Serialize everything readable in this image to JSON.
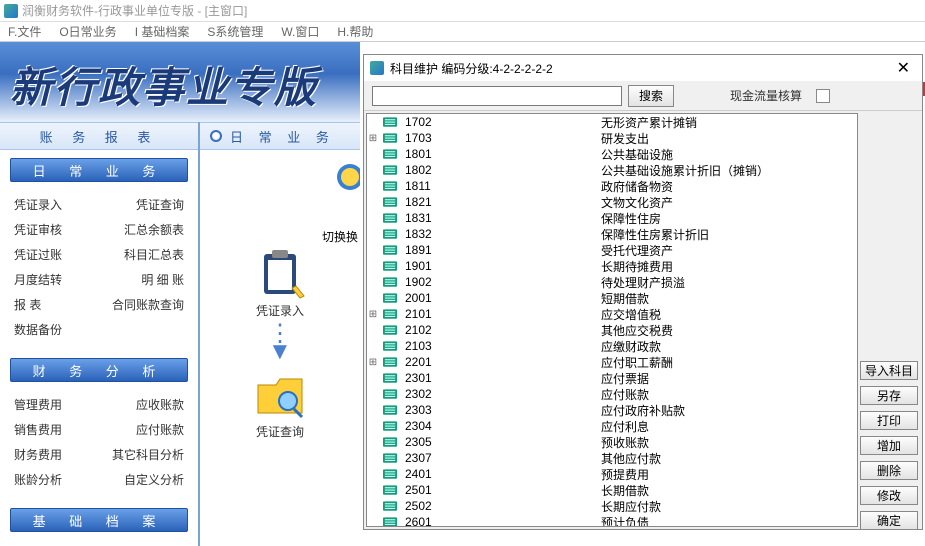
{
  "window_title": "润衡财务软件-行政事业单位专版 - [主窗口]",
  "menu": [
    "F.文件",
    "O日常业务",
    "I 基础档案",
    "S系统管理",
    "W.窗口",
    "H.帮助"
  ],
  "banner": "新行政事业专版",
  "left": {
    "panel1_title": "账 务 报 表",
    "band1": "日 常 业 务",
    "links1": [
      [
        "凭证录入",
        "凭证查询"
      ],
      [
        "凭证审核",
        "汇总余额表"
      ],
      [
        "凭证过账",
        "科目汇总表"
      ],
      [
        "月度结转",
        "明 细 账"
      ],
      [
        "报    表",
        "合同账款查询"
      ],
      [
        "数据备份",
        ""
      ]
    ],
    "band2": "财 务 分 析",
    "links2": [
      [
        "管理费用",
        "应收账款"
      ],
      [
        "销售费用",
        "应付账款"
      ],
      [
        "财务费用",
        "其它科目分析"
      ],
      [
        "账龄分析",
        "自定义分析"
      ]
    ],
    "band3": "基 础 档 案"
  },
  "mid": {
    "title": "日 常 业 务",
    "switch_label": "切换换",
    "icon1_label": "凭证录入",
    "icon2_label": "凭证查询"
  },
  "dialog": {
    "title": "科目维护  编码分级:4-2-2-2-2-2",
    "search_btn": "搜索",
    "cash_label": "现金流量核算",
    "buttons": [
      "导入科目",
      "另存",
      "打印",
      "增加",
      "删除",
      "修改",
      "确定"
    ],
    "rows": [
      {
        "exp": "",
        "code": "1702",
        "name": "无形资产累计摊销"
      },
      {
        "exp": "+",
        "code": "1703",
        "name": "研发支出"
      },
      {
        "exp": "",
        "code": "1801",
        "name": "公共基础设施"
      },
      {
        "exp": "",
        "code": "1802",
        "name": "公共基础设施累计折旧（摊销）"
      },
      {
        "exp": "",
        "code": "1811",
        "name": "政府储备物资"
      },
      {
        "exp": "",
        "code": "1821",
        "name": "文物文化资产"
      },
      {
        "exp": "",
        "code": "1831",
        "name": "保障性住房"
      },
      {
        "exp": "",
        "code": "1832",
        "name": "保障性住房累计折旧"
      },
      {
        "exp": "",
        "code": "1891",
        "name": "受托代理资产"
      },
      {
        "exp": "",
        "code": "1901",
        "name": "长期待摊费用"
      },
      {
        "exp": "",
        "code": "1902",
        "name": "待处理财产损溢"
      },
      {
        "exp": "",
        "code": "2001",
        "name": "短期借款"
      },
      {
        "exp": "+",
        "code": "2101",
        "name": "应交增值税"
      },
      {
        "exp": "",
        "code": "2102",
        "name": "其他应交税费"
      },
      {
        "exp": "",
        "code": "2103",
        "name": "应缴财政款"
      },
      {
        "exp": "+",
        "code": "2201",
        "name": "应付职工薪酬"
      },
      {
        "exp": "",
        "code": "2301",
        "name": "应付票据"
      },
      {
        "exp": "",
        "code": "2302",
        "name": "应付账款"
      },
      {
        "exp": "",
        "code": "2303",
        "name": "应付政府补贴款"
      },
      {
        "exp": "",
        "code": "2304",
        "name": "应付利息"
      },
      {
        "exp": "",
        "code": "2305",
        "name": "预收账款"
      },
      {
        "exp": "",
        "code": "2307",
        "name": "其他应付款"
      },
      {
        "exp": "",
        "code": "2401",
        "name": "预提费用"
      },
      {
        "exp": "",
        "code": "2501",
        "name": "长期借款"
      },
      {
        "exp": "",
        "code": "2502",
        "name": "长期应付款"
      },
      {
        "exp": "",
        "code": "2601",
        "name": "预计负债"
      }
    ]
  }
}
